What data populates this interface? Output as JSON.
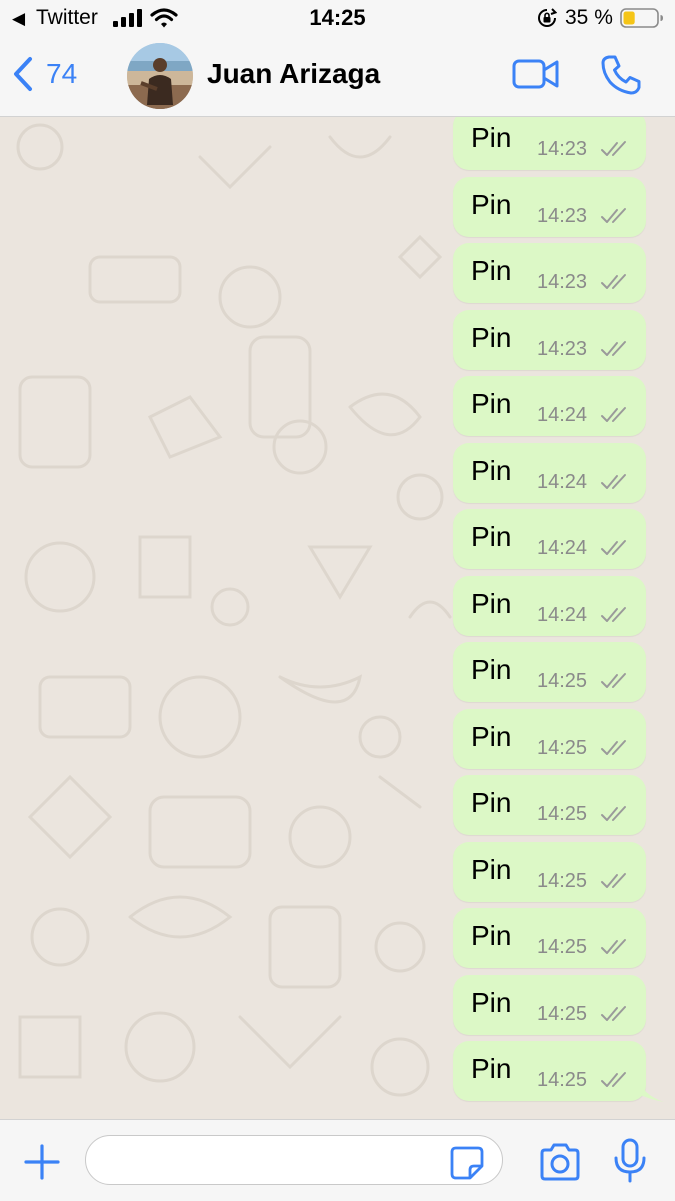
{
  "status_bar": {
    "back_app": "Twitter",
    "time": "14:25",
    "battery_percent": "35 %",
    "battery_level": 0.35
  },
  "header": {
    "back_count": "74",
    "contact_name": "Juan Arizaga"
  },
  "messages": [
    {
      "text": "Pin",
      "time": "14:23"
    },
    {
      "text": "Pin",
      "time": "14:23"
    },
    {
      "text": "Pin",
      "time": "14:23"
    },
    {
      "text": "Pin",
      "time": "14:23"
    },
    {
      "text": "Pin",
      "time": "14:24"
    },
    {
      "text": "Pin",
      "time": "14:24"
    },
    {
      "text": "Pin",
      "time": "14:24"
    },
    {
      "text": "Pin",
      "time": "14:24"
    },
    {
      "text": "Pin",
      "time": "14:25"
    },
    {
      "text": "Pin",
      "time": "14:25"
    },
    {
      "text": "Pin",
      "time": "14:25"
    },
    {
      "text": "Pin",
      "time": "14:25"
    },
    {
      "text": "Pin",
      "time": "14:25"
    },
    {
      "text": "Pin",
      "time": "14:25"
    },
    {
      "text": "Pin",
      "time": "14:25"
    }
  ],
  "input": {
    "value": "",
    "placeholder": ""
  },
  "colors": {
    "accent": "#3b82f6",
    "outgoing_bubble": "#dcf8c6",
    "chat_background": "#ebe5de",
    "ticks": "#9a9a9a",
    "battery_fill": "#f5c518"
  },
  "icons": {
    "status_back": "back-triangle-icon",
    "signal": "signal-bars-icon",
    "wifi": "wifi-icon",
    "rotation_lock": "rotation-lock-icon",
    "battery": "battery-icon",
    "nav_back": "chevron-left-icon",
    "video_call": "video-camera-icon",
    "voice_call": "phone-icon",
    "read_receipt": "double-check-icon",
    "attach": "plus-icon",
    "sticker": "sticker-icon",
    "camera": "camera-icon",
    "microphone": "microphone-icon"
  }
}
